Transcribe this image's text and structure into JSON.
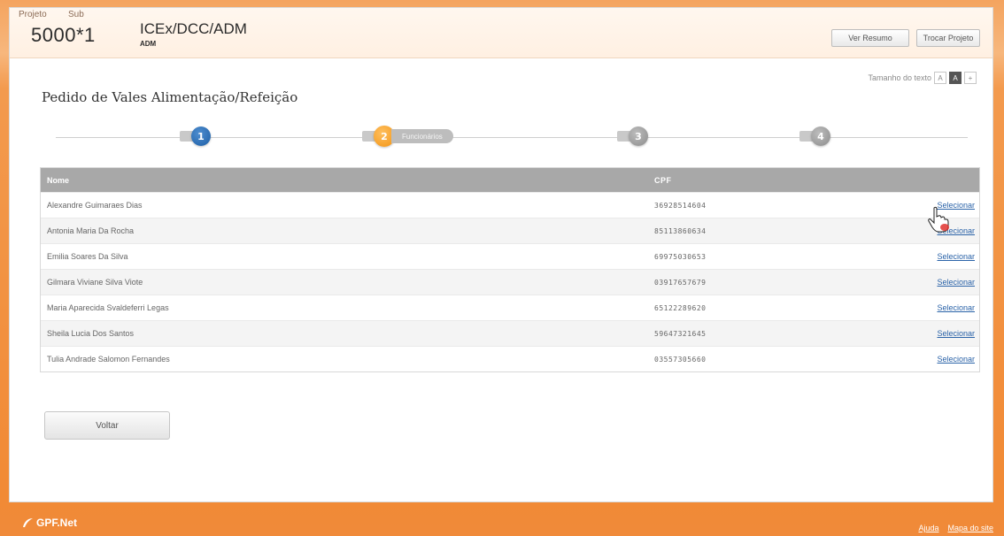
{
  "header": {
    "label_projeto": "Projeto",
    "label_sub": "Sub",
    "project_code": "5000*1",
    "sub_title": "ICEx/DCC/ADM",
    "sub_code": "ADM",
    "btn_resumo": "Ver Resumo",
    "btn_trocar": "Trocar Projeto"
  },
  "text_size": {
    "label": "Tamanho do texto",
    "opts": [
      "A",
      "A",
      "+"
    ]
  },
  "page_title": "Pedido de Vales Alimentação/Refeição",
  "steps": [
    {
      "num": "1",
      "label": ""
    },
    {
      "num": "2",
      "label": "Funcionários"
    },
    {
      "num": "3",
      "label": ""
    },
    {
      "num": "4",
      "label": ""
    }
  ],
  "table": {
    "headers": {
      "nome": "Nome",
      "cpf": "CPF"
    },
    "rows": [
      {
        "nome": "Alexandre Guimaraes Dias",
        "cpf": "36928514604",
        "acao": "Selecionar"
      },
      {
        "nome": "Antonia Maria Da Rocha",
        "cpf": "85113860634",
        "acao": "Selecionar"
      },
      {
        "nome": "Emilia Soares Da Silva",
        "cpf": "69975030653",
        "acao": "Selecionar"
      },
      {
        "nome": "Gilmara Viviane Silva Viote",
        "cpf": "03917657679",
        "acao": "Selecionar"
      },
      {
        "nome": "Maria Aparecida Svaldeferri Legas",
        "cpf": "65122289620",
        "acao": "Selecionar"
      },
      {
        "nome": "Sheila Lucia Dos Santos",
        "cpf": "59647321645",
        "acao": "Selecionar"
      },
      {
        "nome": "Tulia Andrade Salomon Fernandes",
        "cpf": "03557305660",
        "acao": "Selecionar"
      }
    ]
  },
  "btn_voltar": "Voltar",
  "footer": {
    "logo": "GPF.Net",
    "links": [
      "Ajuda",
      "Mapa do site"
    ]
  },
  "colors": {
    "accent_orange": "#f18a35",
    "step_blue": "#1c5ea5",
    "link_blue": "#2b63a8"
  }
}
